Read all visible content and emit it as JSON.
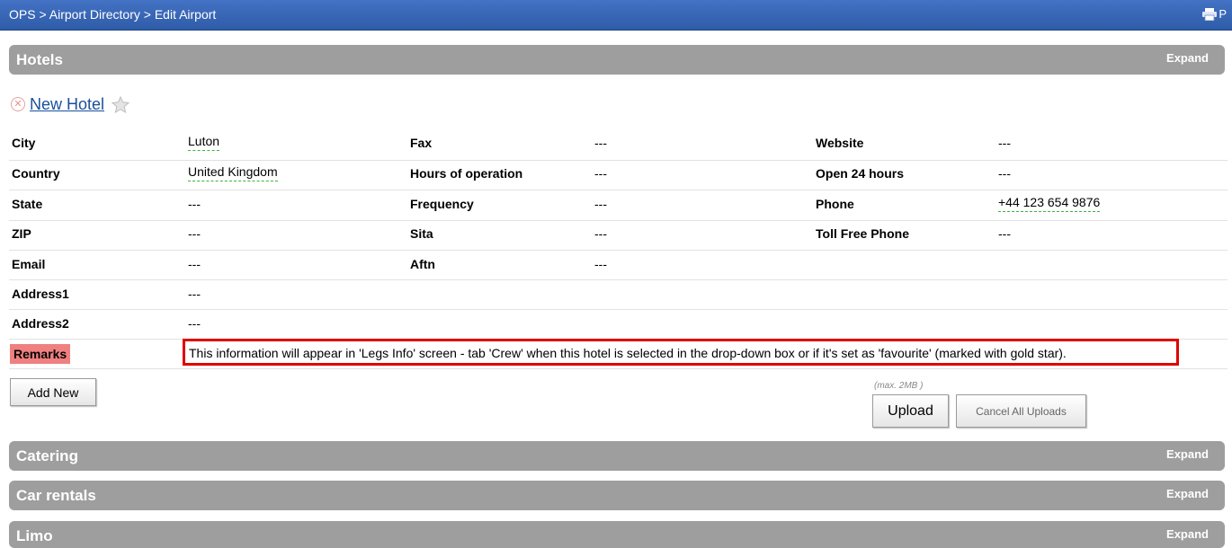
{
  "header": {
    "breadcrumb": "OPS > Airport Directory > Edit Airport",
    "print_label": "P"
  },
  "sections": {
    "hotels": {
      "title": "Hotels",
      "expand": "Expand"
    },
    "catering": {
      "title": "Catering",
      "expand": "Expand"
    },
    "car_rentals": {
      "title": "Car rentals",
      "expand": "Expand"
    },
    "limo": {
      "title": "Limo",
      "expand": "Expand"
    }
  },
  "hotel": {
    "name": "New Hotel",
    "fields": {
      "city": {
        "label": "City",
        "value": "Luton"
      },
      "country": {
        "label": "Country",
        "value": "United Kingdom"
      },
      "state": {
        "label": "State",
        "value": "---"
      },
      "zip": {
        "label": "ZIP",
        "value": "---"
      },
      "email": {
        "label": "Email",
        "value": "---"
      },
      "address1": {
        "label": "Address1",
        "value": "---"
      },
      "address2": {
        "label": "Address2",
        "value": "---"
      },
      "fax": {
        "label": "Fax",
        "value": "---"
      },
      "hours": {
        "label": "Hours of operation",
        "value": "---"
      },
      "frequency": {
        "label": "Frequency",
        "value": "---"
      },
      "sita": {
        "label": "Sita",
        "value": "---"
      },
      "aftn": {
        "label": "Aftn",
        "value": "---"
      },
      "website": {
        "label": "Website",
        "value": "---"
      },
      "open24": {
        "label": "Open 24 hours",
        "value": "---"
      },
      "phone": {
        "label": "Phone",
        "value": "+44 123 654 9876"
      },
      "tollfree": {
        "label": "Toll Free Phone",
        "value": "---"
      }
    },
    "remarks": {
      "label": "Remarks",
      "value": "This information will appear in 'Legs Info' screen - tab 'Crew' when this hotel is selected in the drop-down box or if it's set as 'favourite' (marked with gold star)."
    }
  },
  "actions": {
    "add_new": "Add New",
    "max_note": "(max. 2MB )",
    "upload": "Upload",
    "cancel_uploads": "Cancel All Uploads"
  },
  "colors": {
    "header_bg": "#2e5ca8",
    "section_bg": "#9e9e9e",
    "remarks_highlight": "#f08080",
    "remarks_border": "#e00000",
    "link": "#1a4f9c"
  }
}
